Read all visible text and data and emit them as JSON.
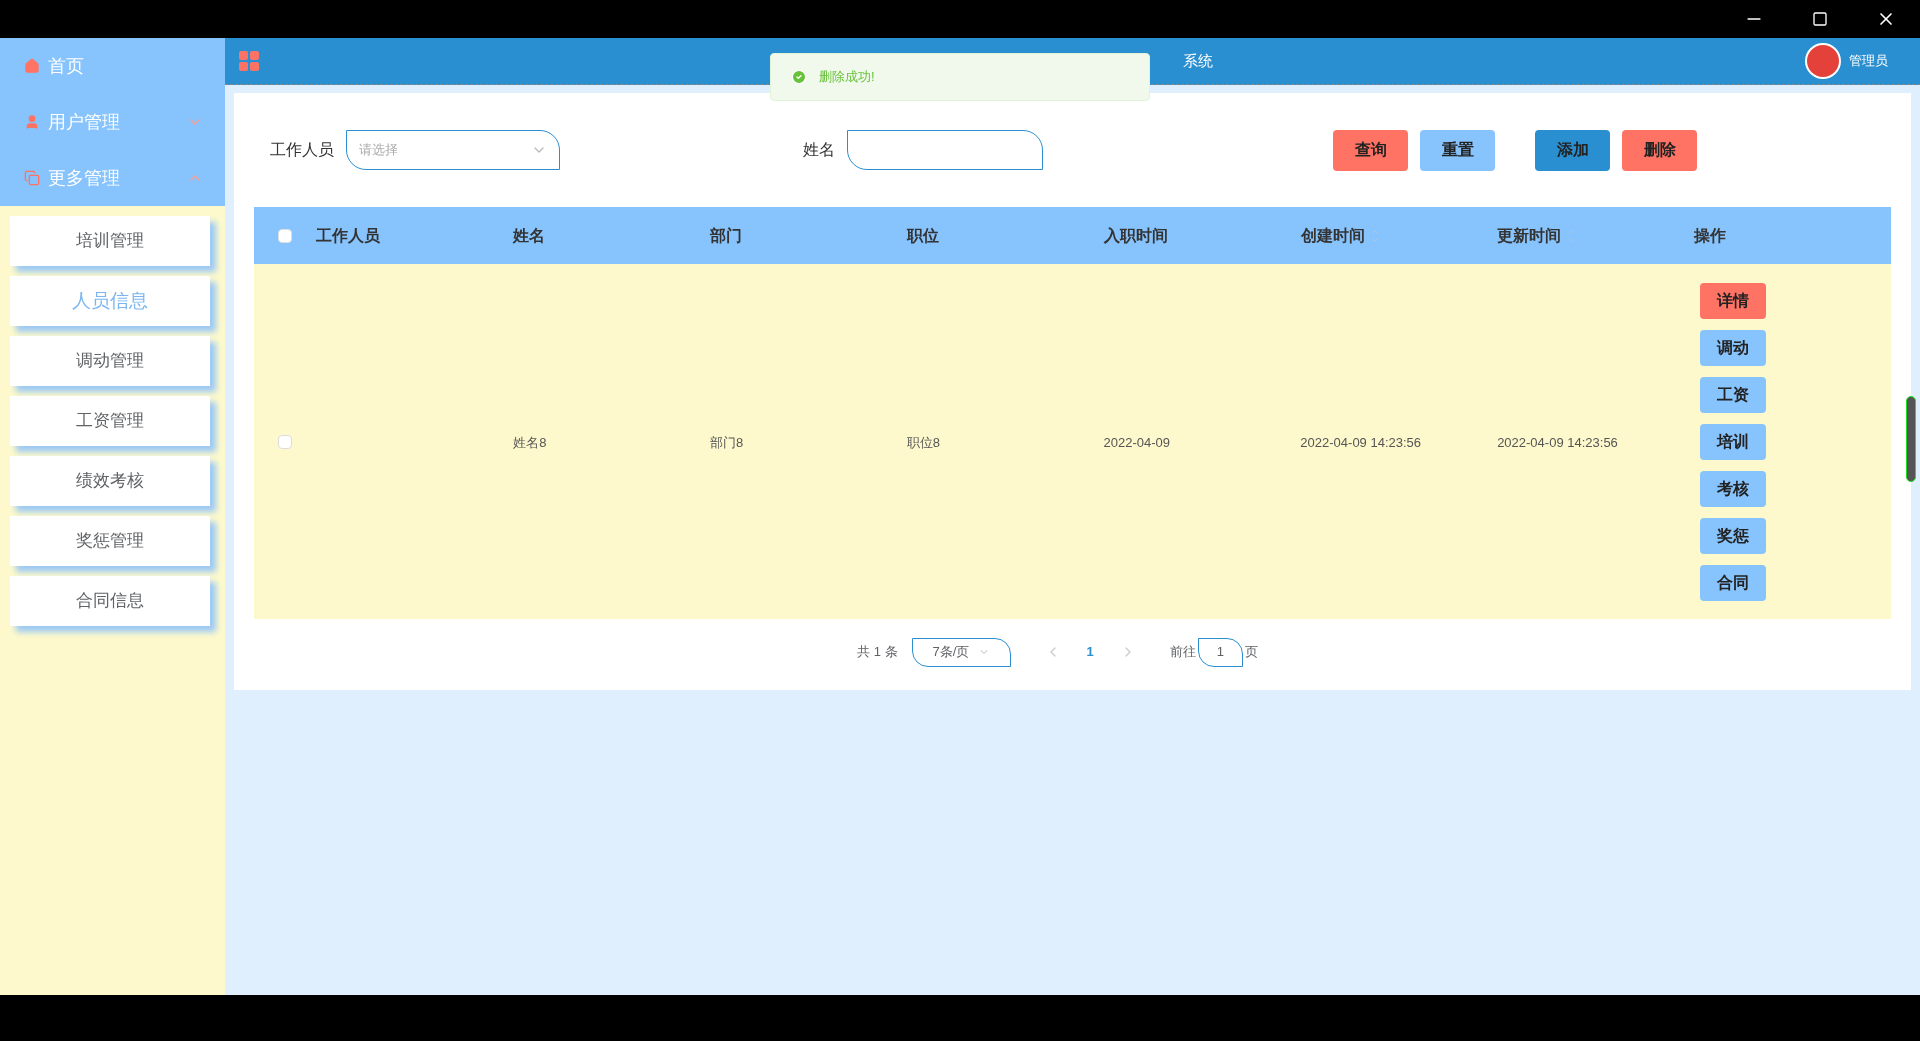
{
  "sidebar": {
    "menus": [
      {
        "kind": "home",
        "label": "首页"
      },
      {
        "kind": "user",
        "label": "用户管理",
        "expanded": false
      },
      {
        "kind": "copy",
        "label": "更多管理",
        "expanded": true,
        "children": [
          {
            "label": "培训管理",
            "selected": false
          },
          {
            "label": "人员信息",
            "selected": true
          },
          {
            "label": "调动管理",
            "selected": false
          },
          {
            "label": "工资管理",
            "selected": false
          },
          {
            "label": "绩效考核",
            "selected": false
          },
          {
            "label": "奖惩管理",
            "selected": false
          },
          {
            "label": "合同信息",
            "selected": false
          }
        ]
      }
    ]
  },
  "header": {
    "title": "系统",
    "user": "管理员"
  },
  "toast": {
    "message": "删除成功!"
  },
  "filters": [
    {
      "label": "工作人员",
      "kind": "select",
      "placeholder": "请选择"
    },
    {
      "label": "姓名",
      "kind": "input"
    }
  ],
  "buttons": [
    {
      "label": "查询",
      "color": "#ff7364"
    },
    {
      "label": "重置",
      "color": "#87c3fc"
    },
    {
      "label": "添加",
      "color": "#2a8fd0"
    },
    {
      "label": "删除",
      "color": "#ff7364"
    }
  ],
  "table": {
    "select_all": {
      "checked": false
    },
    "columns": [
      {
        "label": "工作人员",
        "sortable": false
      },
      {
        "label": "姓名",
        "sortable": false
      },
      {
        "label": "部门",
        "sortable": false
      },
      {
        "label": "职位",
        "sortable": false
      },
      {
        "label": "入职时间",
        "sortable": false
      },
      {
        "label": "创建时间",
        "sortable": true
      },
      {
        "label": "更新时间",
        "sortable": true
      },
      {
        "label": "操作",
        "sortable": false
      }
    ],
    "rows": [
      {
        "checked": false,
        "cells": [
          "",
          "姓名8",
          "部门8",
          "职位8",
          "2022-04-09",
          "2022-04-09 14:23:56",
          "2022-04-09 14:23:56"
        ],
        "actions": [
          {
            "label": "详情",
            "color": "#ff7364"
          },
          {
            "label": "调动",
            "color": "#87c3fc"
          },
          {
            "label": "工资",
            "color": "#87c3fc"
          },
          {
            "label": "培训",
            "color": "#87c3fc"
          },
          {
            "label": "考核",
            "color": "#87c3fc"
          },
          {
            "label": "奖惩",
            "color": "#87c3fc"
          },
          {
            "label": "合同",
            "color": "#87c3fc"
          }
        ]
      }
    ]
  },
  "pagination": {
    "total": "共 1 条",
    "page_size": "7条/页",
    "pages": [
      {
        "label": "1",
        "selected": true
      }
    ],
    "goto_label": "前往",
    "goto_value": "1",
    "page_suffix": "页"
  }
}
